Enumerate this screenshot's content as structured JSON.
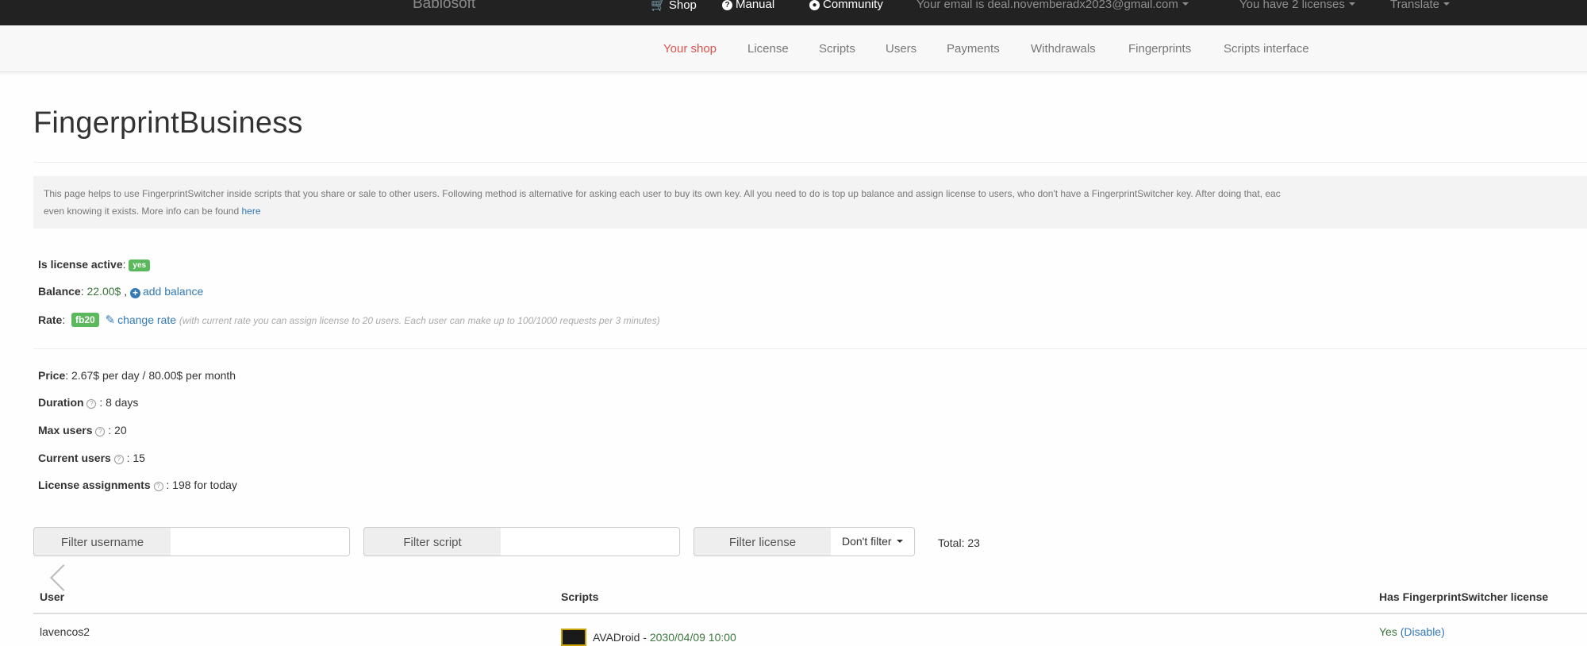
{
  "topbar": {
    "brand": "Bablosoft",
    "shop": "Shop",
    "manual": "Manual",
    "community": "Community",
    "email": "Your email is deal.novemberadx2023@gmail.com",
    "licenses": "You have 2 licenses",
    "translate": "Translate"
  },
  "subnav": {
    "items": [
      "Your shop",
      "License",
      "Scripts",
      "Users",
      "Payments",
      "Withdrawals",
      "Fingerprints",
      "Scripts interface"
    ]
  },
  "page": {
    "title": "FingerprintBusiness",
    "info_line1": "This page helps to use FingerprintSwitcher inside scripts that you share or sale to other users. Following method is alternative for asking each user to buy its own key. All you need to do is top up balance and assign license to users, who don't have a FingerprintSwitcher key. After doing that, eac",
    "info_line2": "even knowing it exists. More info can be found ",
    "info_link": "here"
  },
  "license": {
    "active_label": "Is license active",
    "active_value": "yes",
    "balance_label": "Balance",
    "balance_value": "22.00$",
    "add_balance": "add balance",
    "rate_label": "Rate",
    "rate_value": "fb20",
    "change_rate": "change rate",
    "rate_hint": "(with current rate you can assign license to 20 users. Each user can make up to 100/1000 requests per 3 minutes)"
  },
  "stats": {
    "price_label": "Price",
    "price_value": ": 2.67$ per day / 80.00$ per month",
    "duration_label": "Duration",
    "duration_value": " : 8 days",
    "max_users_label": "Max users",
    "max_users_value": " : 20",
    "current_users_label": "Current users",
    "current_users_value": " : 15",
    "assignments_label": "License assignments",
    "assignments_value": " : 198 for today"
  },
  "filters": {
    "username_label": "Filter username",
    "username_value": "",
    "script_label": "Filter script",
    "script_value": "",
    "license_label": "Filter license",
    "license_dropdown": "Don't filter",
    "total": "Total: 23"
  },
  "table": {
    "headers": [
      "User",
      "Scripts",
      "Has FingerprintSwitcher license"
    ],
    "rows": [
      {
        "user": "lavencos2",
        "script_name": "AVADroid",
        "script_date": "2030/04/09 10:00",
        "has_license": "Yes",
        "action": "Disable"
      }
    ]
  },
  "colors": {
    "accent_red": "#d9534f",
    "link_blue": "#337ab7",
    "success_green": "#5cb85c"
  }
}
